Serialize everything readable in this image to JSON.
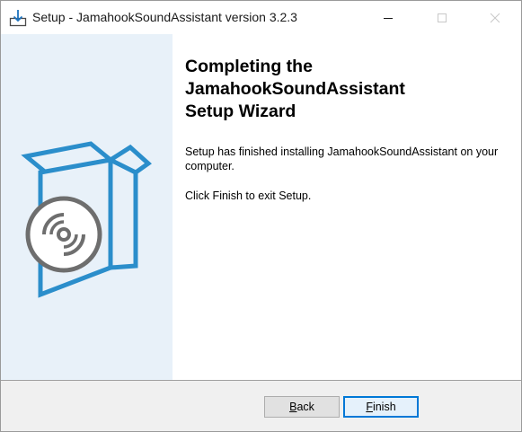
{
  "window": {
    "title": "Setup - JamahookSoundAssistant version 3.2.3"
  },
  "heading": {
    "line1": "Completing the",
    "line2": "JamahookSoundAssistant",
    "line3": "Setup Wizard"
  },
  "body": {
    "finished_message": "Setup has finished installing JamahookSoundAssistant on your computer.",
    "finish_hint": "Click Finish to exit Setup."
  },
  "buttons": {
    "back_accel": "B",
    "back_rest": "ack",
    "finish_accel": "F",
    "finish_rest": "inish"
  },
  "icons": {
    "app": "installer-download-icon",
    "minimize": "minimize-icon",
    "maximize": "maximize-icon",
    "close": "close-icon",
    "banner": "software-box-disc-icon"
  },
  "colors": {
    "accent": "#0078d7",
    "box_blue": "#2b8ecb",
    "side_panel": "#e8f1f9",
    "disc_gray": "#6e6e6e"
  }
}
